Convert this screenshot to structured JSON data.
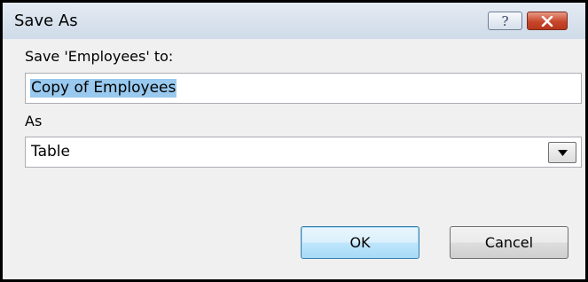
{
  "window": {
    "title": "Save As",
    "help_label": "?"
  },
  "form": {
    "save_to_label": "Save 'Employees' to:",
    "name_value": "Copy of Employees",
    "as_label": "As",
    "as_selected": "Table"
  },
  "buttons": {
    "ok_label": "OK",
    "cancel_label": "Cancel"
  },
  "colors": {
    "selection_highlight": "#99c9ef",
    "close_button": "#c8462a",
    "default_button_border": "#3c7fb1"
  }
}
